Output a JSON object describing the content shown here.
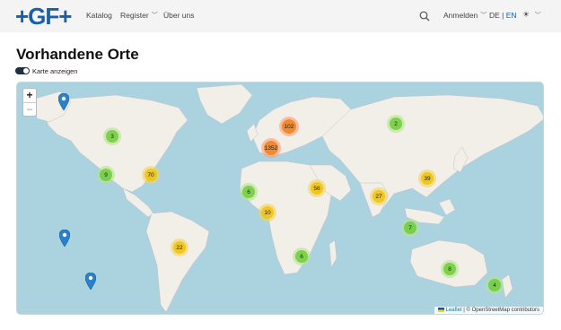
{
  "header": {
    "logo_text": "+GF+",
    "nav": [
      {
        "label": "Katalog"
      },
      {
        "label": "Register"
      },
      {
        "label": "Über uns"
      }
    ],
    "login_label": "Anmelden",
    "lang_de": "DE",
    "lang_sep": " | ",
    "lang_en": "EN",
    "theme_icon": "sun-icon"
  },
  "page": {
    "title": "Vorhandene Orte",
    "toggle_label": "Karte anzeigen",
    "toggle_on": true
  },
  "map": {
    "zoom_in": "+",
    "zoom_out": "−",
    "clusters": [
      {
        "count": "102",
        "size": "large"
      },
      {
        "count": "1352",
        "size": "large"
      },
      {
        "count": "2",
        "size": "small"
      },
      {
        "count": "3",
        "size": "small"
      },
      {
        "count": "9",
        "size": "small"
      },
      {
        "count": "70",
        "size": "medium"
      },
      {
        "count": "6",
        "size": "small"
      },
      {
        "count": "56",
        "size": "medium"
      },
      {
        "count": "10",
        "size": "medium"
      },
      {
        "count": "27",
        "size": "medium"
      },
      {
        "count": "39",
        "size": "medium"
      },
      {
        "count": "7",
        "size": "small"
      },
      {
        "count": "22",
        "size": "medium"
      },
      {
        "count": "6",
        "size": "small"
      },
      {
        "count": "8",
        "size": "small"
      },
      {
        "count": "4",
        "size": "small"
      }
    ],
    "attribution_leaflet": "Leaflet",
    "attribution_rest": " | © OpenStreetMap contributors",
    "colors": {
      "water": "#aad3df",
      "land": "#f2efe9",
      "marker": "#2a81cb"
    }
  }
}
